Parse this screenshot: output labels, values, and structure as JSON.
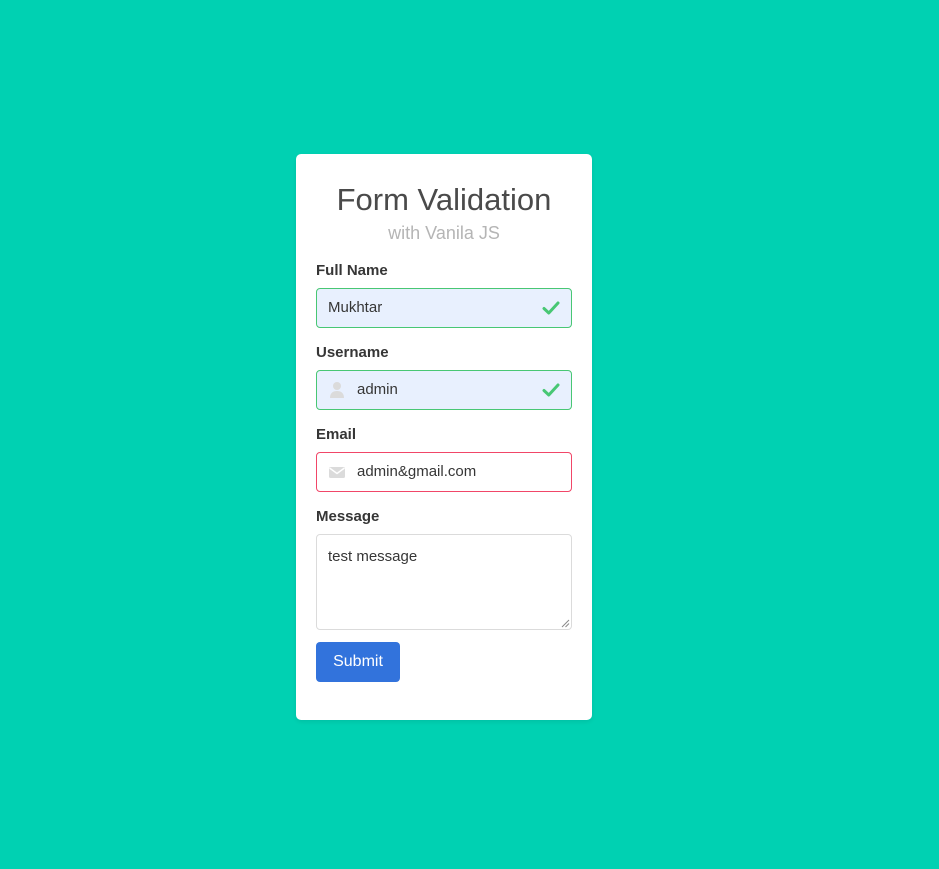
{
  "colors": {
    "background": "#00d1b2",
    "success": "#48c774",
    "danger": "#f14668",
    "primary": "#3273dc"
  },
  "header": {
    "title": "Form Validation",
    "subtitle": "with Vanila JS"
  },
  "form": {
    "full_name": {
      "label": "Full Name",
      "value": "Mukhtar",
      "state": "success",
      "right_icon": "check-icon"
    },
    "username": {
      "label": "Username",
      "value": "admin",
      "state": "success",
      "left_icon": "user-icon",
      "right_icon": "check-icon"
    },
    "email": {
      "label": "Email",
      "value": "admin&gmail.com",
      "state": "error",
      "left_icon": "envelope-icon"
    },
    "message": {
      "label": "Message",
      "value": "test message"
    },
    "submit_label": "Submit"
  }
}
